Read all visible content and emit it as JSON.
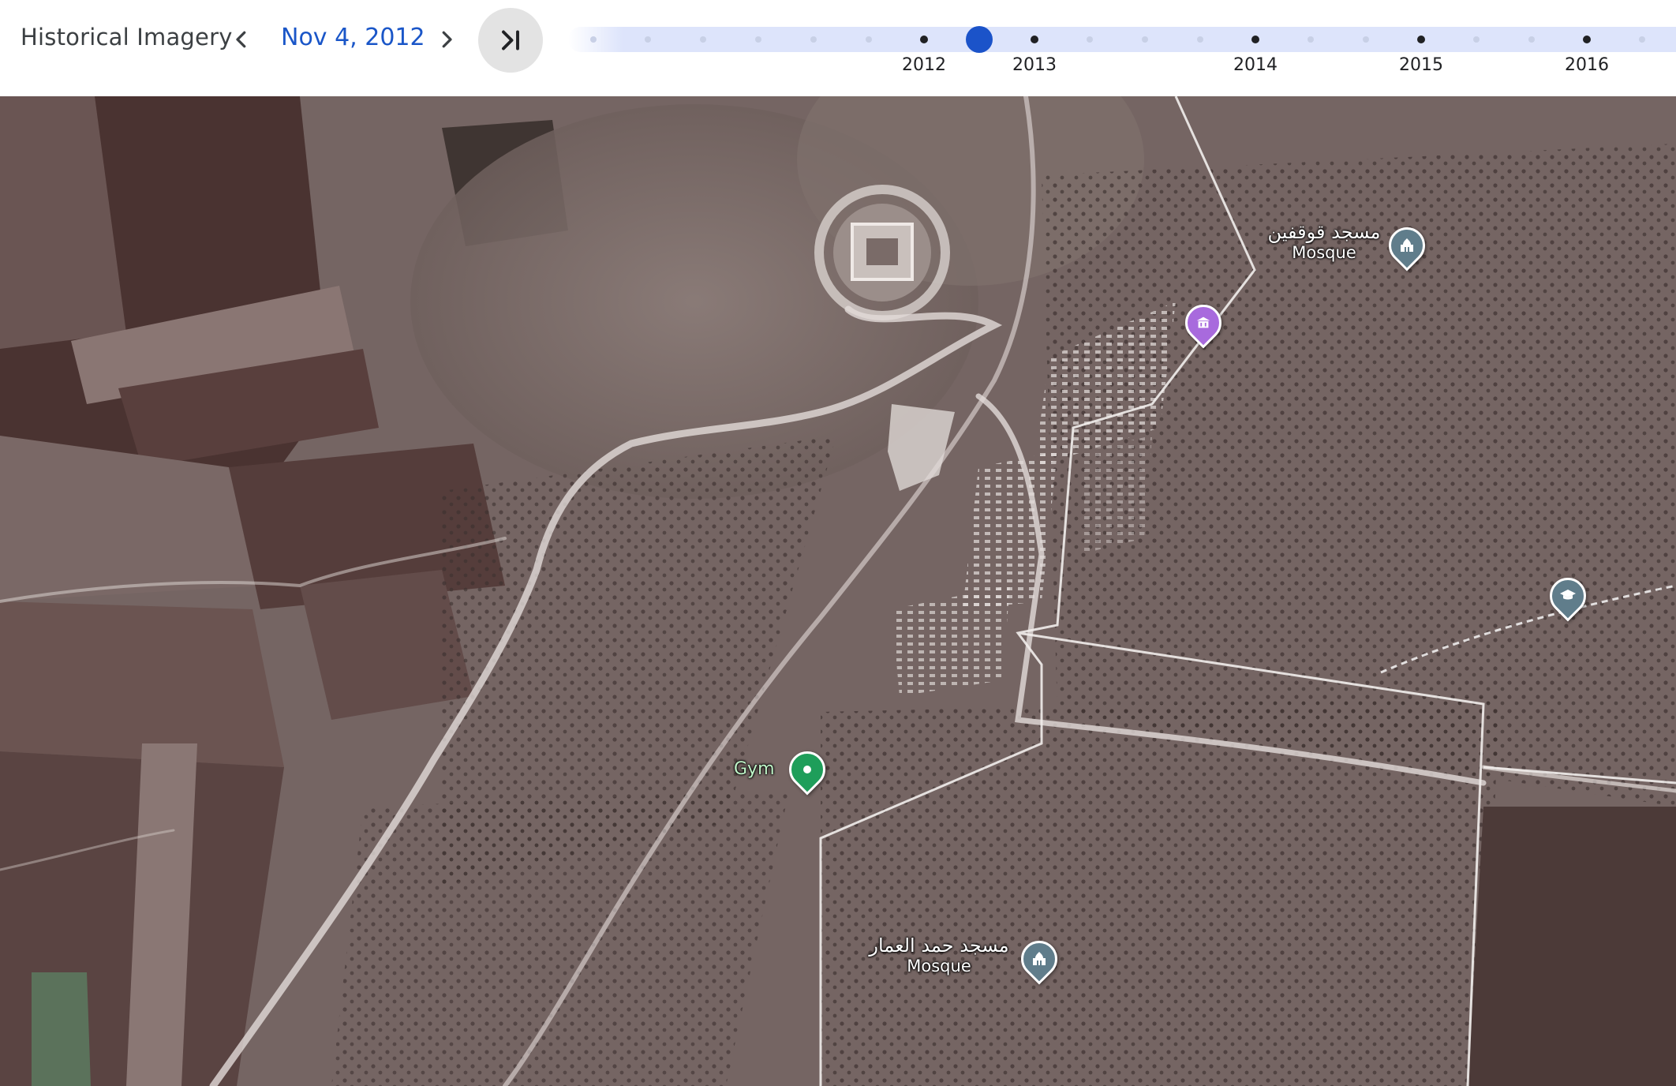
{
  "header": {
    "title": "Historical Imagery",
    "date": "Nov 4, 2012",
    "prev_icon": "chevron-left-icon",
    "next_icon": "chevron-right-icon",
    "latest_icon": "skip-to-latest-icon"
  },
  "timeline": {
    "years": [
      "2012",
      "2013",
      "2014",
      "2015",
      "2016"
    ],
    "selected": "Nov 4, 2012",
    "colors": {
      "track": "#dde4fb",
      "selected": "#1b53c9",
      "year_dot": "#202124",
      "minor_dot": "#c8d0e6"
    }
  },
  "map": {
    "pois": [
      {
        "id": "mosque-north",
        "name": "مسجد قوقفين",
        "type": "Mosque",
        "icon": "mosque-icon",
        "color": "#607d8b"
      },
      {
        "id": "landmark",
        "name": "",
        "type": "",
        "icon": "museum-icon",
        "color": "#a86add"
      },
      {
        "id": "school",
        "name": "",
        "type": "",
        "icon": "school-icon",
        "color": "#607d8b"
      },
      {
        "id": "gym",
        "name": "Gym",
        "type": "",
        "icon": "gym-pin-icon",
        "color": "#1e9e5a"
      },
      {
        "id": "mosque-south",
        "name": "مسجد حمد العمار",
        "type": "Mosque",
        "icon": "mosque-icon",
        "color": "#607d8b"
      }
    ]
  }
}
